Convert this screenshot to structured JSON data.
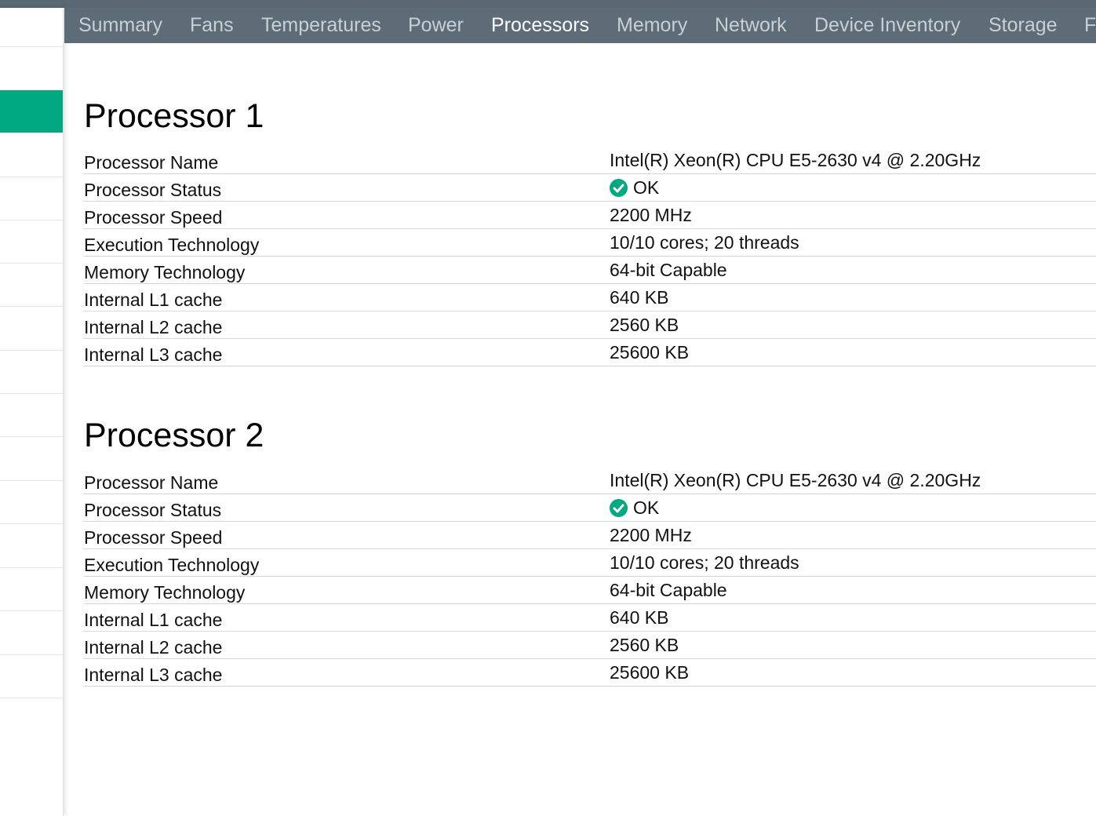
{
  "tabs": [
    {
      "label": "Summary",
      "active": false
    },
    {
      "label": "Fans",
      "active": false
    },
    {
      "label": "Temperatures",
      "active": false
    },
    {
      "label": "Power",
      "active": false
    },
    {
      "label": "Processors",
      "active": true
    },
    {
      "label": "Memory",
      "active": false
    },
    {
      "label": "Network",
      "active": false
    },
    {
      "label": "Device Inventory",
      "active": false
    },
    {
      "label": "Storage",
      "active": false
    },
    {
      "label": "F",
      "active": false
    }
  ],
  "processors": [
    {
      "title": "Processor 1",
      "rows": [
        {
          "label": "Processor Name",
          "value": "Intel(R) Xeon(R) CPU E5-2630 v4 @ 2.20GHz"
        },
        {
          "label": "Processor Status",
          "value": "OK",
          "icon": "ok-check-icon"
        },
        {
          "label": "Processor Speed",
          "value": "2200 MHz"
        },
        {
          "label": "Execution Technology",
          "value": "10/10 cores; 20 threads"
        },
        {
          "label": "Memory Technology",
          "value": "64-bit Capable"
        },
        {
          "label": "Internal L1 cache",
          "value": "640 KB"
        },
        {
          "label": "Internal L2 cache",
          "value": "2560 KB"
        },
        {
          "label": "Internal L3 cache",
          "value": "25600 KB"
        }
      ]
    },
    {
      "title": "Processor 2",
      "rows": [
        {
          "label": "Processor Name",
          "value": "Intel(R) Xeon(R) CPU E5-2630 v4 @ 2.20GHz"
        },
        {
          "label": "Processor Status",
          "value": "OK",
          "icon": "ok-check-icon"
        },
        {
          "label": "Processor Speed",
          "value": "2200 MHz"
        },
        {
          "label": "Execution Technology",
          "value": "10/10 cores; 20 threads"
        },
        {
          "label": "Memory Technology",
          "value": "64-bit Capable"
        },
        {
          "label": "Internal L1 cache",
          "value": "640 KB"
        },
        {
          "label": "Internal L2 cache",
          "value": "2560 KB"
        },
        {
          "label": "Internal L3 cache",
          "value": "25600 KB"
        }
      ]
    }
  ],
  "colors": {
    "accent": "#01a982",
    "tabbar": "#5d6c77",
    "tab_inactive_text": "#c8d0d6",
    "tab_active_text": "#ffffff"
  }
}
